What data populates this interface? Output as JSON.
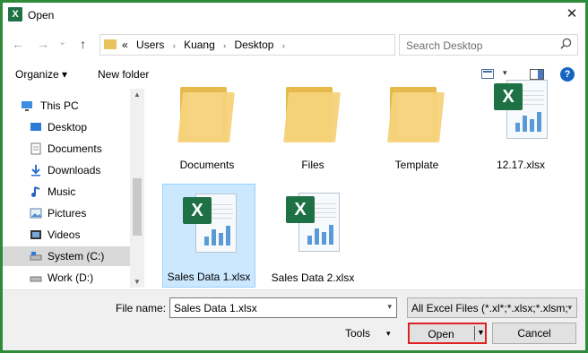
{
  "window": {
    "title": "Open",
    "title_icon": "X",
    "close": "✕"
  },
  "nav": {
    "back": "←",
    "forward": "→",
    "recent": "⌄",
    "up": "↑"
  },
  "address": {
    "overflow": "«",
    "crumbs": [
      "Users",
      "Kuang",
      "Desktop"
    ],
    "separator": "›"
  },
  "search": {
    "placeholder": "Search Desktop"
  },
  "toolbar": {
    "organize": "Organize ▾",
    "new_folder": "New folder",
    "help": "?"
  },
  "sidebar": {
    "items": [
      {
        "label": "This PC",
        "icon": "computer-icon"
      },
      {
        "label": "Desktop",
        "icon": "desktop-icon"
      },
      {
        "label": "Documents",
        "icon": "documents-icon"
      },
      {
        "label": "Downloads",
        "icon": "downloads-icon"
      },
      {
        "label": "Music",
        "icon": "music-icon"
      },
      {
        "label": "Pictures",
        "icon": "pictures-icon"
      },
      {
        "label": "Videos",
        "icon": "videos-icon"
      },
      {
        "label": "System (C:)",
        "icon": "drive-icon"
      },
      {
        "label": "Work (D:)",
        "icon": "drive-icon"
      }
    ]
  },
  "files": [
    {
      "name": "Documents",
      "type": "folder"
    },
    {
      "name": "Files",
      "type": "folder"
    },
    {
      "name": "Template",
      "type": "folder"
    },
    {
      "name": "12.17.xlsx",
      "type": "excel"
    },
    {
      "name": "Sales Data 1.xlsx",
      "type": "excel",
      "selected": true
    },
    {
      "name": "Sales Data 2.xlsx",
      "type": "excel"
    }
  ],
  "bottom": {
    "file_name_label": "File name:",
    "file_name_value": "Sales Data 1.xlsx",
    "file_type": "All Excel Files (*.xl*;*.xlsx;*.xlsm;",
    "tools": "Tools",
    "open": "Open",
    "cancel": "Cancel"
  },
  "colors": {
    "excel_green": "#1e7145",
    "folder_yellow": "#f6d27a",
    "selection": "#cce8ff",
    "highlight_border": "#dd2222"
  }
}
